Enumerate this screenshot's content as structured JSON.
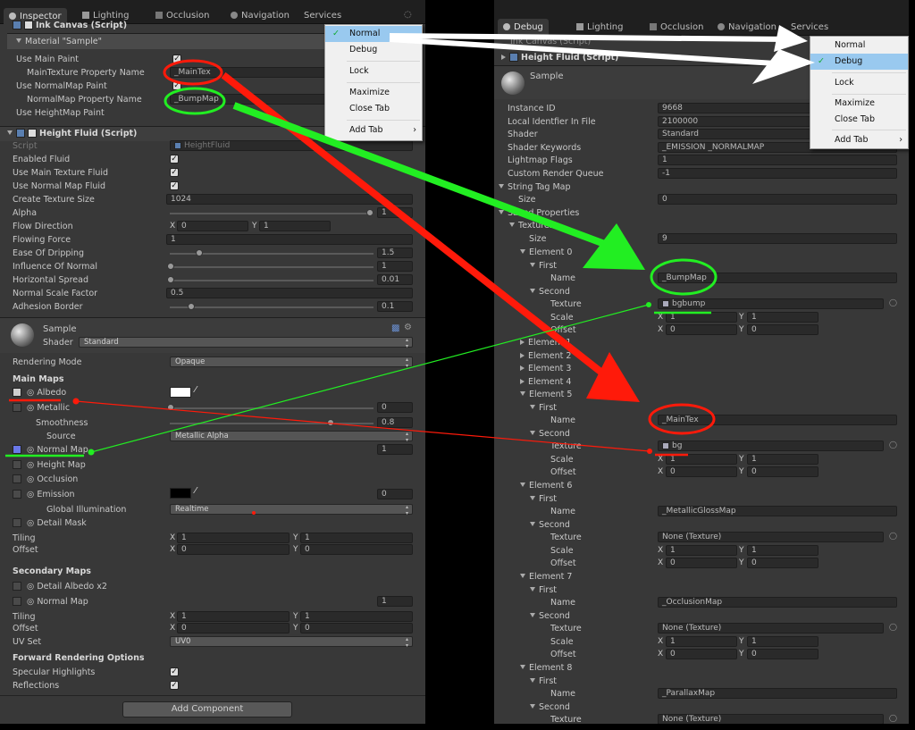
{
  "left": {
    "tabs": [
      "Inspector",
      "Lighting",
      "Occlusion",
      "Navigation",
      "Services"
    ],
    "ink_canvas_title": "Ink Canvas (Script)",
    "material_label": "Material \"Sample\"",
    "ink_rows": [
      "Use Main Paint",
      "MainTexture Property Name",
      "Use NormalMap Paint",
      "NormalMap Property Name",
      "Use HeightMap Paint"
    ],
    "maintex_value": "_MainTex",
    "bumpmap_value": "_BumpMap",
    "menu": {
      "items": [
        "Normal",
        "Debug",
        "Lock",
        "Maximize",
        "Close Tab",
        "Add Tab"
      ],
      "selected": "Normal"
    },
    "hf_title": "Height Fluid (Script)",
    "hf_script_label": "Script",
    "hf_script_value": "HeightFluid",
    "hf_labels": [
      "Enabled Fluid",
      "Use Main Texture Fluid",
      "Use Normal Map Fluid",
      "Create Texture Size",
      "Alpha",
      "Flow Direction",
      "Flowing Force",
      "Ease Of Dripping",
      "Influence Of Normal",
      "Horizontal Spread",
      "Normal Scale Factor",
      "Adhesion Border"
    ],
    "tex_size": "1024",
    "alpha": "1",
    "flow_x": "0",
    "flow_y": "1",
    "x_lbl": "X",
    "y_lbl": "Y",
    "flowing_force": "1",
    "ease_dripping": "1.5",
    "influence_normal": "1",
    "horizontal_spread": "0.01",
    "normal_scale": "0.5",
    "adhesion": "0.1",
    "mat_name": "Sample",
    "shader_label": "Shader",
    "shader_value": "Standard",
    "rendering_mode_label": "Rendering Mode",
    "rendering_mode_value": "Opaque",
    "main_maps": "Main Maps",
    "albedo": "Albedo",
    "metallic": "Metallic",
    "metallic_val": "0",
    "smoothness": "Smoothness",
    "smoothness_val": "0.8",
    "source": "Source",
    "source_val": "Metallic Alpha",
    "normal_map": "Normal Map",
    "normal_map_val": "1",
    "height_map": "Height Map",
    "occlusion": "Occlusion",
    "emission": "Emission",
    "emission_val": "0",
    "gi": "Global Illumination",
    "gi_val": "Realtime",
    "detail_mask": "Detail Mask",
    "tiling": "Tiling",
    "offset": "Offset",
    "tiling_x": "1",
    "tiling_y": "1",
    "offset_x": "0",
    "offset_y": "0",
    "secondary_maps": "Secondary Maps",
    "detail_albedo": "Detail Albedo x2",
    "sec_normal": "Normal Map",
    "sec_normal_val": "1",
    "sec_tiling_x": "1",
    "sec_tiling_y": "1",
    "sec_offset_x": "0",
    "sec_offset_y": "0",
    "uv_set": "UV Set",
    "uv_set_val": "UV0",
    "forward_opts": "Forward Rendering Options",
    "spec_highlights": "Specular Highlights",
    "reflections": "Reflections",
    "add_component": "Add Component"
  },
  "right": {
    "tabs": [
      "Debug",
      "Lighting",
      "Occlusion",
      "Navigation",
      "Services"
    ],
    "partial_title": "Ink Canvas (Script)",
    "hf_title": "Height Fluid (Script)",
    "mat_name": "Sample",
    "menu": {
      "items": [
        "Normal",
        "Debug",
        "Lock",
        "Maximize",
        "Close Tab",
        "Add Tab"
      ],
      "selected": "Debug"
    },
    "props": [
      {
        "label": "Instance ID",
        "value": "9668"
      },
      {
        "label": "Local Identfier In File",
        "value": "2100000"
      },
      {
        "label": "Shader",
        "value": "Standard"
      },
      {
        "label": "Shader Keywords",
        "value": "_EMISSION _NORMALMAP"
      },
      {
        "label": "Lightmap Flags",
        "value": "1"
      },
      {
        "label": "Custom Render Queue",
        "value": "-1"
      }
    ],
    "string_tag_map": "String Tag Map",
    "size": "Size",
    "size0": "0",
    "saved_props": "Saved Properties",
    "textures": "Textures",
    "size9": "9",
    "element": "Element",
    "first": "First",
    "second": "Second",
    "name": "Name",
    "texture": "Texture",
    "scale": "Scale",
    "offset": "Offset",
    "e0_name": "_BumpMap",
    "e0_tex": "bgbump",
    "e5_name": "_MainTex",
    "e5_tex": "bg",
    "e6_name": "_MetallicGlossMap",
    "e7_name": "_OcclusionMap",
    "e8_name": "_ParallaxMap",
    "none_tex": "None (Texture)",
    "e_labels": [
      "Element 0",
      "Element 1",
      "Element 2",
      "Element 3",
      "Element 4",
      "Element 5",
      "Element 6",
      "Element 7",
      "Element 8"
    ],
    "one": "1",
    "zero": "0",
    "x_lbl": "X",
    "y_lbl": "Y"
  },
  "colors": {
    "red": "#ff1a0a",
    "green": "#22ee22",
    "white": "#ffffff",
    "selection": "#99c9ef"
  }
}
